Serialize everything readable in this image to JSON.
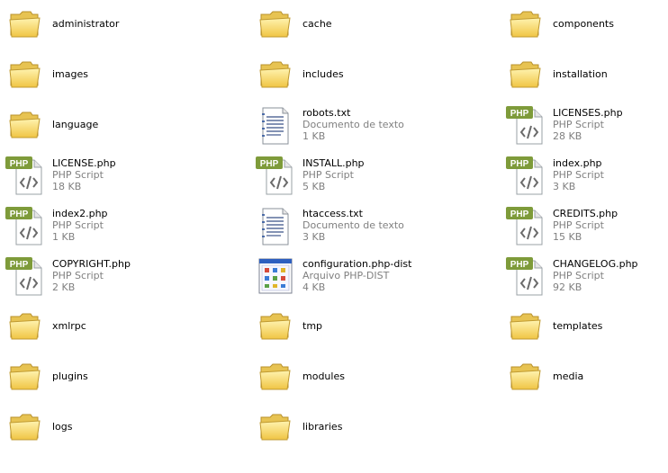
{
  "items": [
    {
      "name": "administrator",
      "kind": "folder"
    },
    {
      "name": "cache",
      "kind": "folder"
    },
    {
      "name": "components",
      "kind": "folder"
    },
    {
      "name": "images",
      "kind": "folder"
    },
    {
      "name": "includes",
      "kind": "folder"
    },
    {
      "name": "installation",
      "kind": "folder"
    },
    {
      "name": "language",
      "kind": "folder"
    },
    {
      "name": "robots.txt",
      "kind": "txt",
      "type": "Documento de texto",
      "size": "1 KB"
    },
    {
      "name": "LICENSES.php",
      "kind": "php",
      "type": "PHP Script",
      "size": "28 KB"
    },
    {
      "name": "LICENSE.php",
      "kind": "php",
      "type": "PHP Script",
      "size": "18 KB"
    },
    {
      "name": "INSTALL.php",
      "kind": "php",
      "type": "PHP Script",
      "size": "5 KB"
    },
    {
      "name": "index.php",
      "kind": "php",
      "type": "PHP Script",
      "size": "3 KB"
    },
    {
      "name": "index2.php",
      "kind": "php",
      "type": "PHP Script",
      "size": "1 KB"
    },
    {
      "name": "htaccess.txt",
      "kind": "txt",
      "type": "Documento de texto",
      "size": "3 KB"
    },
    {
      "name": "CREDITS.php",
      "kind": "php",
      "type": "PHP Script",
      "size": "15 KB"
    },
    {
      "name": "COPYRIGHT.php",
      "kind": "php",
      "type": "PHP Script",
      "size": "2 KB"
    },
    {
      "name": "configuration.php-dist",
      "kind": "dist",
      "type": "Arquivo PHP-DIST",
      "size": "4 KB"
    },
    {
      "name": "CHANGELOG.php",
      "kind": "php",
      "type": "PHP Script",
      "size": "92 KB"
    },
    {
      "name": "xmlrpc",
      "kind": "folder"
    },
    {
      "name": "tmp",
      "kind": "folder"
    },
    {
      "name": "templates",
      "kind": "folder"
    },
    {
      "name": "plugins",
      "kind": "folder"
    },
    {
      "name": "modules",
      "kind": "folder"
    },
    {
      "name": "media",
      "kind": "folder"
    },
    {
      "name": "logs",
      "kind": "folder"
    },
    {
      "name": "libraries",
      "kind": "folder"
    }
  ],
  "badge_label": "PHP",
  "colors": {
    "folder_body": "#f5d66a",
    "folder_dark": "#c9a12c",
    "php_badge": "#7e9b3a",
    "text_secondary": "#808080"
  }
}
